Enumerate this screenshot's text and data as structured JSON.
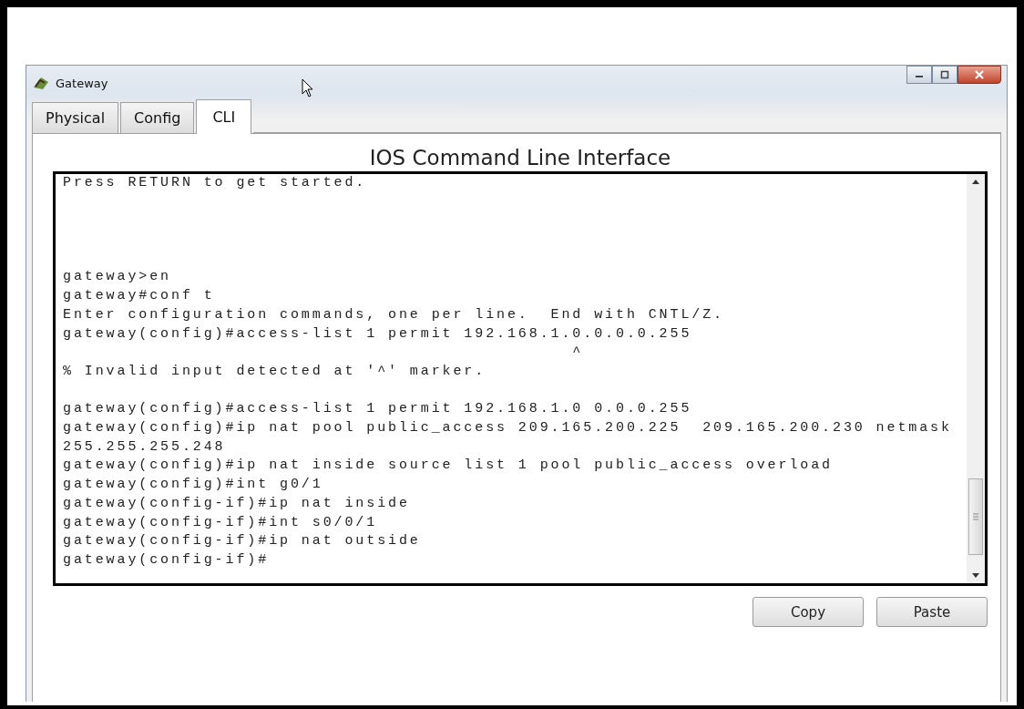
{
  "window": {
    "title": "Gateway"
  },
  "tabs": [
    {
      "label": "Physical",
      "selected": false
    },
    {
      "label": "Config",
      "selected": false
    },
    {
      "label": "CLI",
      "selected": true
    }
  ],
  "panel_title": "IOS Command Line Interface",
  "terminal": [
    {
      "kind": "line",
      "text": "Press RETURN to get started."
    },
    {
      "kind": "blank"
    },
    {
      "kind": "blank"
    },
    {
      "kind": "blank"
    },
    {
      "kind": "blank"
    },
    {
      "kind": "line",
      "text": "gateway>en"
    },
    {
      "kind": "line",
      "text": "gateway#conf t"
    },
    {
      "kind": "line",
      "text": "Enter configuration commands, one per line.  End with CNTL/Z."
    },
    {
      "kind": "line",
      "text": "gateway(config)#access-list 1 permit 192.168.1.0.0.0.0.255"
    },
    {
      "kind": "line",
      "text": "                                               ^"
    },
    {
      "kind": "line",
      "text": "% Invalid input detected at '^' marker."
    },
    {
      "kind": "blank"
    },
    {
      "kind": "line",
      "text": "gateway(config)#access-list 1 permit 192.168.1.0 0.0.0.255"
    },
    {
      "kind": "line",
      "text": "gateway(config)#ip nat pool public_access 209.165.200.225  209.165.200.230 netmask"
    },
    {
      "kind": "line",
      "text": "255.255.255.248"
    },
    {
      "kind": "line",
      "text": "gateway(config)#ip nat inside source list 1 pool public_access overload"
    },
    {
      "kind": "line",
      "text": "gateway(config)#int g0/1"
    },
    {
      "kind": "line",
      "text": "gateway(config-if)#ip nat inside"
    },
    {
      "kind": "line",
      "text": "gateway(config-if)#int s0/0/1"
    },
    {
      "kind": "line",
      "text": "gateway(config-if)#ip nat outside"
    },
    {
      "kind": "line",
      "text": "gateway(config-if)#"
    }
  ],
  "buttons": [
    "Copy",
    "Paste"
  ]
}
